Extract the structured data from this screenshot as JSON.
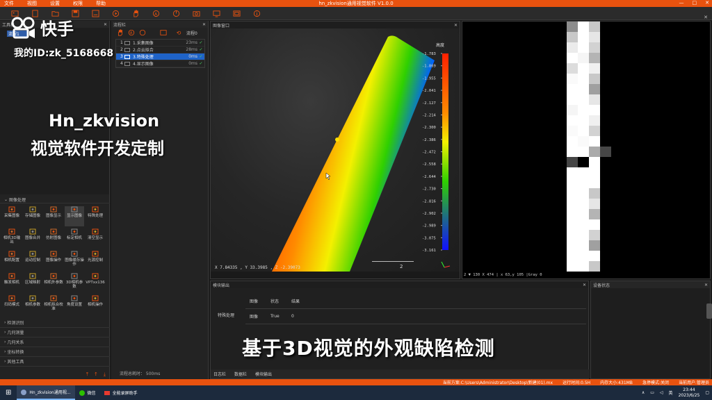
{
  "titlebar": {
    "menu": [
      "文件",
      "视图",
      "设置",
      "权限",
      "帮助"
    ],
    "title": "hn_zkvision通用视觉软件 V1.0.0",
    "controls": [
      "—",
      "□",
      "✕"
    ]
  },
  "left_panel": {
    "title": "工具栏",
    "close": "✕",
    "tree_item": "流程1",
    "section_image": "图像处理",
    "tools": [
      "采集图像",
      "存储图像",
      "图像显示",
      "显示图像",
      "特殊处理",
      "相机3D输出",
      "图像合并",
      "仿射图像",
      "标定相机",
      "清空显示",
      "相机配置",
      "运动控制",
      "图像操作",
      "图像缓存操作",
      "光源控制",
      "触发相机",
      "区域映射",
      "相机外参数",
      "3D相机参数",
      "VPTxx136",
      "扫码模式",
      "相机参数",
      "相机拟合校准",
      "角度设置",
      "相机操作"
    ],
    "collapsed_sections": [
      "检测识别",
      "几何测量",
      "几何关系",
      "坐标转换",
      "其他工具"
    ],
    "footer_icons": [
      "⤒",
      "↑",
      "⤓"
    ]
  },
  "flow_panel": {
    "title": "流程栏",
    "close": "✕",
    "toolbar_label": "流程0",
    "rows": [
      {
        "idx": "1",
        "name": "1.采集图像",
        "time": "23ms",
        "check": "✓"
      },
      {
        "idx": "2",
        "name": "2.点云拟合",
        "time": "28ms",
        "check": "✓"
      },
      {
        "idx": "3",
        "name": "3.特殊处理",
        "time": "0ms",
        "check": "✓"
      },
      {
        "idx": "4",
        "name": "4.显示图像",
        "time": "0ms",
        "check": "✓"
      }
    ],
    "total_time": "流程总耗时： 500ms"
  },
  "image_window": {
    "title": "图像窗口",
    "close": "✕",
    "coord": "X 7.84335 , Y 33.3985 , Z -2.39073",
    "scale_label": "2",
    "colorbar_title": "高度",
    "colorbar_ticks": [
      "-1.783",
      "-1.869",
      "-1.955",
      "-2.041",
      "-2.127",
      "-2.214",
      "-2.300",
      "-2.386",
      "-2.472",
      "-2.558",
      "-2.644",
      "-2.730",
      "-2.816",
      "-2.902",
      "-2.989",
      "-3.075",
      "-3.161"
    ],
    "colors": {
      "red": "#ff2000",
      "orange": "#ff8a00",
      "yellow": "#f4f000",
      "green": "#2fd000",
      "blue": "#1010ff"
    }
  },
  "dark_window": {
    "close": "✕",
    "status": "2 ▼ 130 X 474 | x 63,y 105 |Gray 0"
  },
  "module_output": {
    "title": "模块输出",
    "close": "✕",
    "row_label": "特殊处理",
    "header": [
      "图像",
      "状态",
      "结果"
    ],
    "row": [
      "图像",
      "True",
      "0"
    ],
    "tabs": [
      "日志栏",
      "数据栏",
      "模块输出"
    ]
  },
  "device_status": {
    "title": "设备状态",
    "close": "✕"
  },
  "statusbar": {
    "path": "当前方案:C:\\Users\\Administrator\\Desktop\\新建(01).mx",
    "runtime": "运行时间:0.5H",
    "memory": "内存大小:431MB",
    "mode": "急停模式:关闭",
    "user": "当前用户:管理员"
  },
  "taskbar": {
    "tasks": [
      "Hn_zkvision通用视...",
      "微信",
      "全能录屏助手"
    ],
    "lang": "英",
    "time": "23:44",
    "date": "2023/6/25"
  },
  "overlays": {
    "logo_text": "快手",
    "id_text": "我的ID:zk_5168668",
    "promo_title": "Hn_zkvision",
    "promo_sub": "视觉软件开发定制",
    "caption": "基于3D视觉的外观缺陷检测"
  }
}
